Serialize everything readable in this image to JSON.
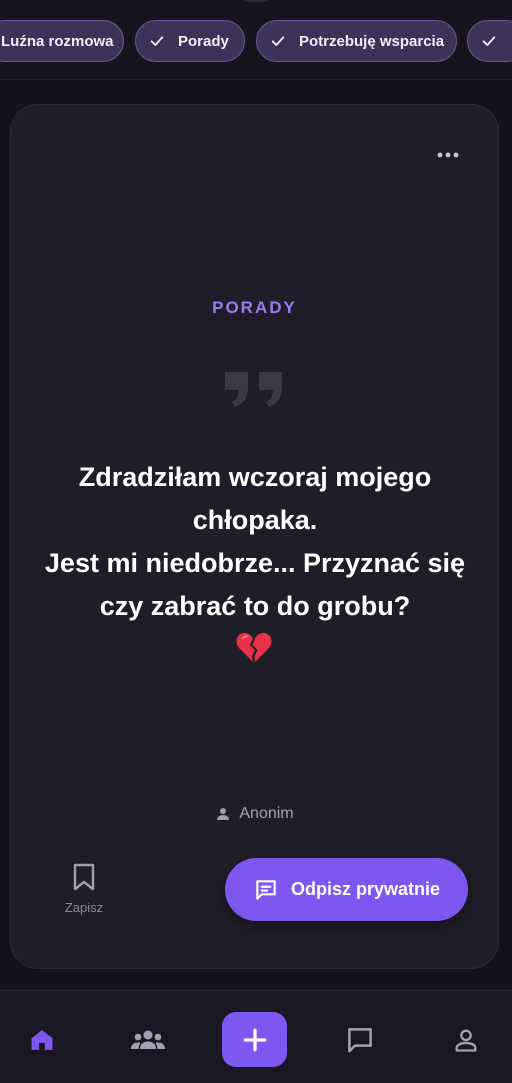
{
  "filters": {
    "chips": [
      {
        "label": "Luźna rozmowa",
        "checked": false
      },
      {
        "label": "Porady",
        "checked": true
      },
      {
        "label": "Potrzebuję wsparcia",
        "checked": true
      },
      {
        "label": "",
        "checked": true
      }
    ]
  },
  "post": {
    "category": "PORADY",
    "text": "Zdradziłam wczoraj mojego chłopaka.\nJest mi niedobrze... Przyznać się czy zabrać to do grobu?",
    "emoji": "broken-heart-icon",
    "author": "Anonim",
    "save_label": "Zapisz",
    "reply_label": "Odpisz prywatnie"
  },
  "nav": {
    "items": [
      "home-icon",
      "community-icon",
      "add-icon",
      "messages-icon",
      "profile-icon"
    ],
    "active": "home"
  },
  "colors": {
    "accent": "#7e57f0",
    "category": "#9b7cf0",
    "background": "#14131c",
    "card": "#1f1e28",
    "chip_bg": "#3d3359"
  }
}
